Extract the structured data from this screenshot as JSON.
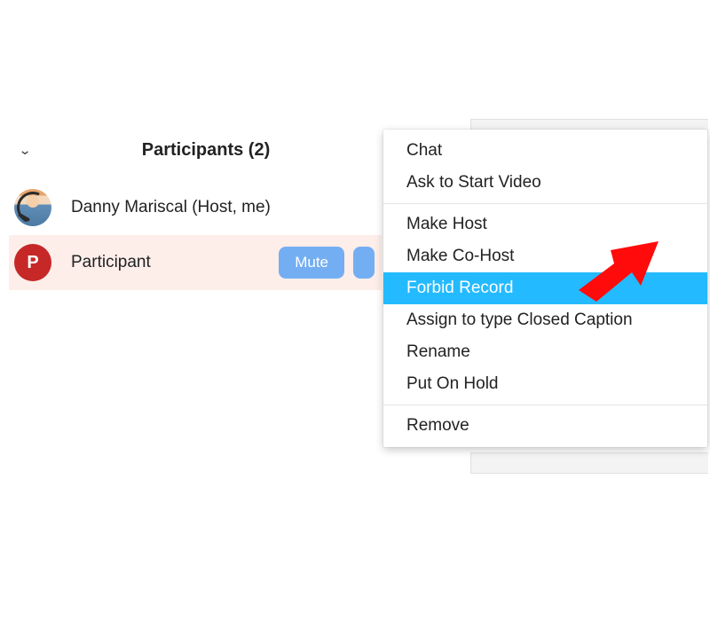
{
  "panel": {
    "title": "Participants (2)",
    "rows": [
      {
        "avatar_letter": "",
        "label": "Danny Mariscal (Host, me)"
      },
      {
        "avatar_letter": "P",
        "label": "Participant"
      }
    ],
    "mute_label": "Mute"
  },
  "menu": {
    "groups": [
      [
        "Chat",
        "Ask to Start Video"
      ],
      [
        "Make Host",
        "Make Co-Host",
        "Forbid Record",
        "Assign to type Closed Caption",
        "Rename",
        "Put On Hold"
      ],
      [
        "Remove"
      ]
    ],
    "highlighted": "Forbid Record"
  },
  "colors": {
    "accent": "#74aef2",
    "highlight": "#24baff",
    "avatar_bg": "#c62828",
    "row_selected": "#fdeeea",
    "arrow": "#ff0b0b"
  }
}
